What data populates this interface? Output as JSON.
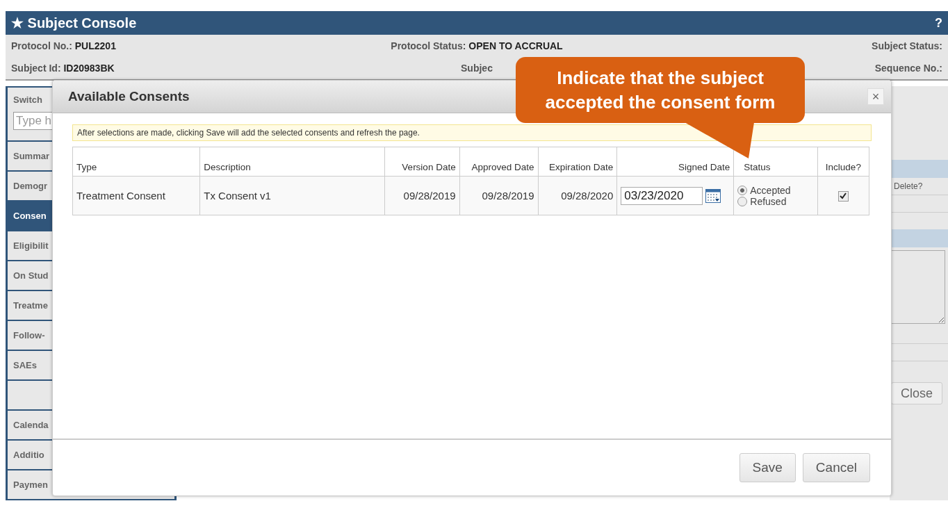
{
  "header": {
    "icon": "★",
    "title": "Subject Console",
    "help": "?"
  },
  "info_rows": [
    [
      {
        "label": "Protocol No.:",
        "value": "PUL2201"
      },
      {
        "label": "Protocol Status:",
        "value": "OPEN TO ACCRUAL"
      },
      {
        "label": "Subject Status:"
      }
    ],
    [
      {
        "label": "Subject Id:",
        "value": "ID20983BK"
      },
      {
        "label": "Subjec"
      },
      {
        "label": "Sequence No.:"
      }
    ]
  ],
  "sidebar": {
    "switch_label": "Switch",
    "search_placeholder": "Type h",
    "items": [
      {
        "label": "Summar",
        "selected": false
      },
      {
        "label": "Demogr",
        "selected": false
      },
      {
        "label": "Consen",
        "selected": true
      },
      {
        "label": "Eligibilit",
        "selected": false
      },
      {
        "label": "On Stud",
        "selected": false
      },
      {
        "label": "Treatme",
        "selected": false
      },
      {
        "label": "Follow-",
        "selected": false
      },
      {
        "label": "SAEs",
        "selected": false
      },
      {
        "selected": false
      },
      {
        "label": "Calenda",
        "selected": false
      },
      {
        "label": "Additio",
        "selected": false
      },
      {
        "label": "Paymen",
        "selected": false
      }
    ]
  },
  "background_panel": {
    "column_label": "Delete?",
    "close_button": "Close"
  },
  "dialog": {
    "title": "Available Consents",
    "close": "×",
    "notice": "After selections are made, clicking Save will add the selected consents and refresh the page.",
    "columns": [
      "Type",
      "Description",
      "Version Date",
      "Approved Date",
      "Expiration Date",
      "Signed Date",
      "Status",
      "Include?"
    ],
    "rows": [
      {
        "type": "Treatment Consent",
        "description": "Tx Consent v1",
        "version_date": "09/28/2019",
        "approved_date": "09/28/2019",
        "expiration_date": "09/28/2020",
        "signed_date": "03/23/2020",
        "status_options": [
          {
            "label": "Accepted",
            "selected": true
          },
          {
            "label": "Refused",
            "selected": false
          }
        ],
        "include": true
      }
    ],
    "buttons": [
      "Save",
      "Cancel"
    ]
  },
  "callout": {
    "text": "Indicate that the subject accepted the consent form"
  }
}
